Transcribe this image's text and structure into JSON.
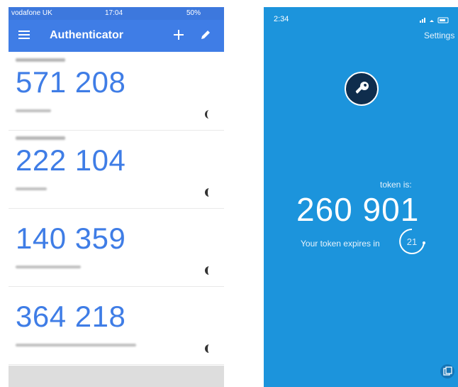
{
  "left_app": {
    "status_bar": {
      "carrier": "vodafone UK",
      "time": "17:04",
      "battery": "50%"
    },
    "toolbar": {
      "title": "Authenticator",
      "menu_icon": "menu-icon",
      "add_icon": "add-icon",
      "edit_icon": "edit-icon"
    },
    "accounts": [
      {
        "code": "571 208"
      },
      {
        "code": "222 104"
      },
      {
        "code": "140 359"
      },
      {
        "code": "364 218"
      }
    ]
  },
  "right_app": {
    "status_bar": {
      "time": "2:34"
    },
    "settings_label": "Settings",
    "key_icon": "key-icon",
    "token_label": "token is:",
    "token": "260 901",
    "expires_label": "Your token expires in",
    "expires_seconds": "21",
    "copy_icon": "copy-icon",
    "colors": {
      "background": "#1c94dc",
      "badge": "#0f2d4d"
    }
  },
  "colors": {
    "accent": "#3f7de6",
    "status_bar": "#3d78dd"
  }
}
